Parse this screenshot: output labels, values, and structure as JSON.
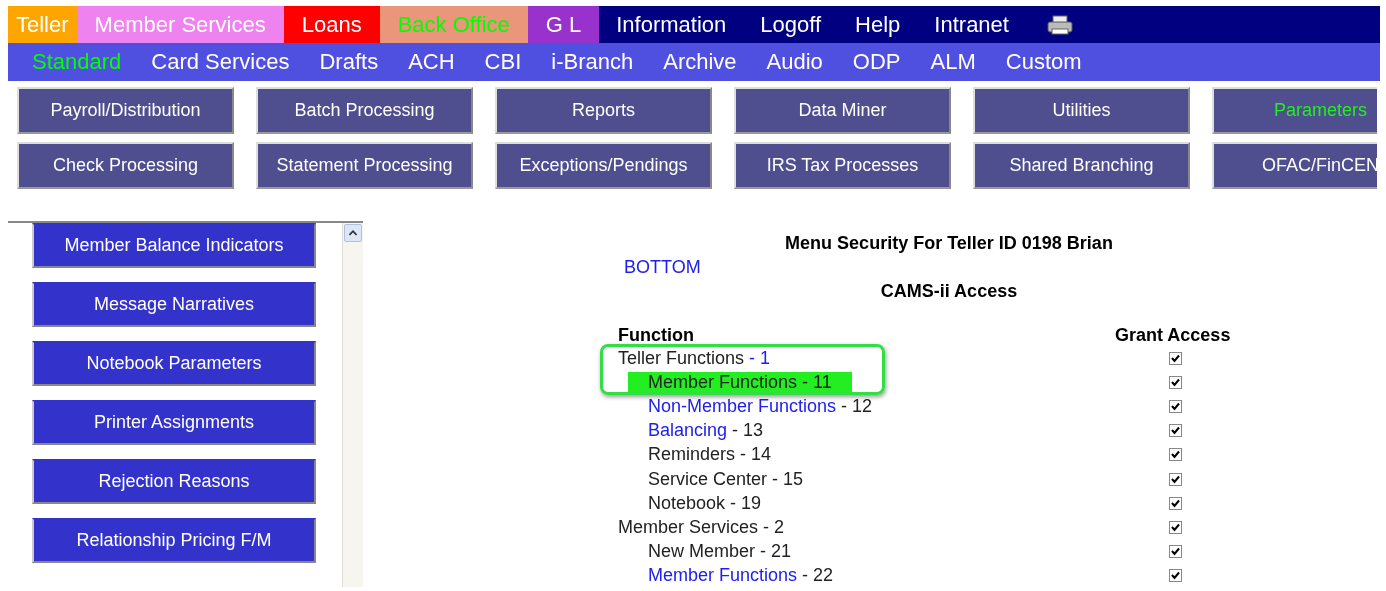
{
  "main_menu": [
    {
      "label": "Teller",
      "color": "#ffa500",
      "selected": false
    },
    {
      "label": "Member Services",
      "color": "#ee82ee",
      "selected": false
    },
    {
      "label": "Loans",
      "color": "#ff0000",
      "selected": false
    },
    {
      "label": "Back Office",
      "color": "#e9967a",
      "selected": true
    },
    {
      "label": "G L",
      "color": "#9932cc",
      "selected": false
    },
    {
      "label": "Information",
      "selected": false
    },
    {
      "label": "Logoff",
      "selected": false
    },
    {
      "label": "Help",
      "selected": false
    },
    {
      "label": "Intranet",
      "selected": false
    }
  ],
  "sub_menu": [
    {
      "label": "Standard",
      "selected": true
    },
    {
      "label": "Card Services",
      "selected": false
    },
    {
      "label": "Drafts",
      "selected": false
    },
    {
      "label": "ACH",
      "selected": false
    },
    {
      "label": "CBI",
      "selected": false
    },
    {
      "label": "i-Branch",
      "selected": false
    },
    {
      "label": "Archive",
      "selected": false
    },
    {
      "label": "Audio",
      "selected": false
    },
    {
      "label": "ODP",
      "selected": false
    },
    {
      "label": "ALM",
      "selected": false
    },
    {
      "label": "Custom",
      "selected": false
    }
  ],
  "section_buttons": [
    {
      "label": "Payroll/Distribution",
      "selected": false
    },
    {
      "label": "Batch Processing",
      "selected": false
    },
    {
      "label": "Reports",
      "selected": false
    },
    {
      "label": "Data Miner",
      "selected": false
    },
    {
      "label": "Utilities",
      "selected": false
    },
    {
      "label": "Parameters",
      "selected": true
    },
    {
      "label": "Check Processing",
      "selected": false
    },
    {
      "label": "Statement Processing",
      "selected": false
    },
    {
      "label": "Exceptions/Pendings",
      "selected": false
    },
    {
      "label": "IRS Tax Processes",
      "selected": false
    },
    {
      "label": "Shared Branching",
      "selected": false
    },
    {
      "label": "OFAC/FinCEN",
      "selected": false
    }
  ],
  "sidebar": {
    "items": [
      "Member Balance Indicators",
      "Message Narratives",
      "Notebook Parameters",
      "Printer Assignments",
      "Rejection Reasons",
      "Relationship Pricing F/M"
    ]
  },
  "content": {
    "title": "Menu Security For Teller ID 0198 Brian",
    "bottom_link": "BOTTOM",
    "subtitle": "CAMS-ii Access",
    "columns": [
      "Function",
      "Grant Access"
    ],
    "rows": [
      {
        "label": "Teller Functions",
        "link": false,
        "suffix": " - 1",
        "suffix_link": true,
        "highlighted": false,
        "granted": true,
        "children": [
          {
            "label": "Member Functions",
            "link": false,
            "suffix": " - 11",
            "suffix_link": false,
            "highlighted": true,
            "granted": true
          },
          {
            "label": "Non-Member Functions",
            "link": true,
            "suffix": " - 12",
            "suffix_link": false,
            "highlighted": false,
            "granted": true
          },
          {
            "label": "Balancing",
            "link": true,
            "suffix": " - 13",
            "suffix_link": false,
            "highlighted": false,
            "granted": true
          },
          {
            "label": "Reminders",
            "link": false,
            "suffix": " - 14",
            "suffix_link": false,
            "highlighted": false,
            "granted": true
          },
          {
            "label": "Service Center",
            "link": false,
            "suffix": " - 15",
            "suffix_link": false,
            "highlighted": false,
            "granted": true
          },
          {
            "label": "Notebook",
            "link": false,
            "suffix": " - 19",
            "suffix_link": false,
            "highlighted": false,
            "granted": true
          }
        ]
      },
      {
        "label": "Member Services",
        "link": false,
        "suffix": " - 2",
        "suffix_link": false,
        "highlighted": false,
        "granted": true,
        "children": [
          {
            "label": "New Member",
            "link": false,
            "suffix": " - 21",
            "suffix_link": false,
            "highlighted": false,
            "granted": true
          },
          {
            "label": "Member Functions",
            "link": true,
            "suffix": " - 22",
            "suffix_link": false,
            "highlighted": false,
            "granted": true
          }
        ]
      }
    ]
  }
}
